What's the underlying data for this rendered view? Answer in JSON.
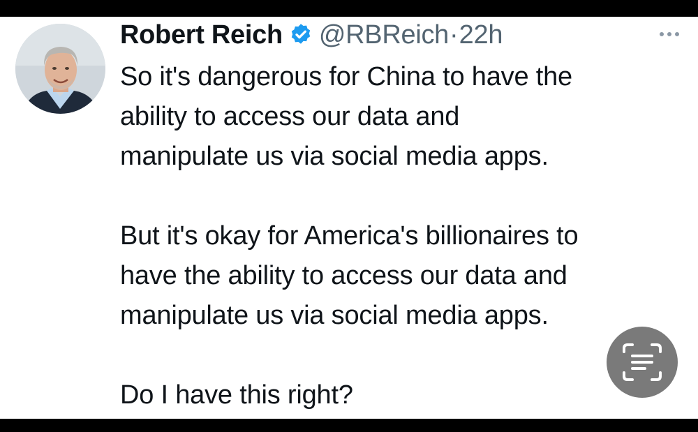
{
  "tweet": {
    "author_name": "Robert Reich",
    "handle": "@RBReich",
    "separator": "·",
    "time": "22h",
    "verified_color": "#1d9bf0",
    "lines_para1": [
      "So it's dangerous for China to have the",
      "ability to access our data and",
      "manipulate us via social media apps."
    ],
    "lines_para2": [
      "But it's okay for America's billionaires to",
      "have the ability to access our data and",
      "manipulate us via social media apps."
    ],
    "line_para3": "Do I have this right?"
  },
  "icons": {
    "verified": "verified-badge-icon",
    "more": "more-options-icon",
    "lens": "live-text-scan-icon"
  }
}
